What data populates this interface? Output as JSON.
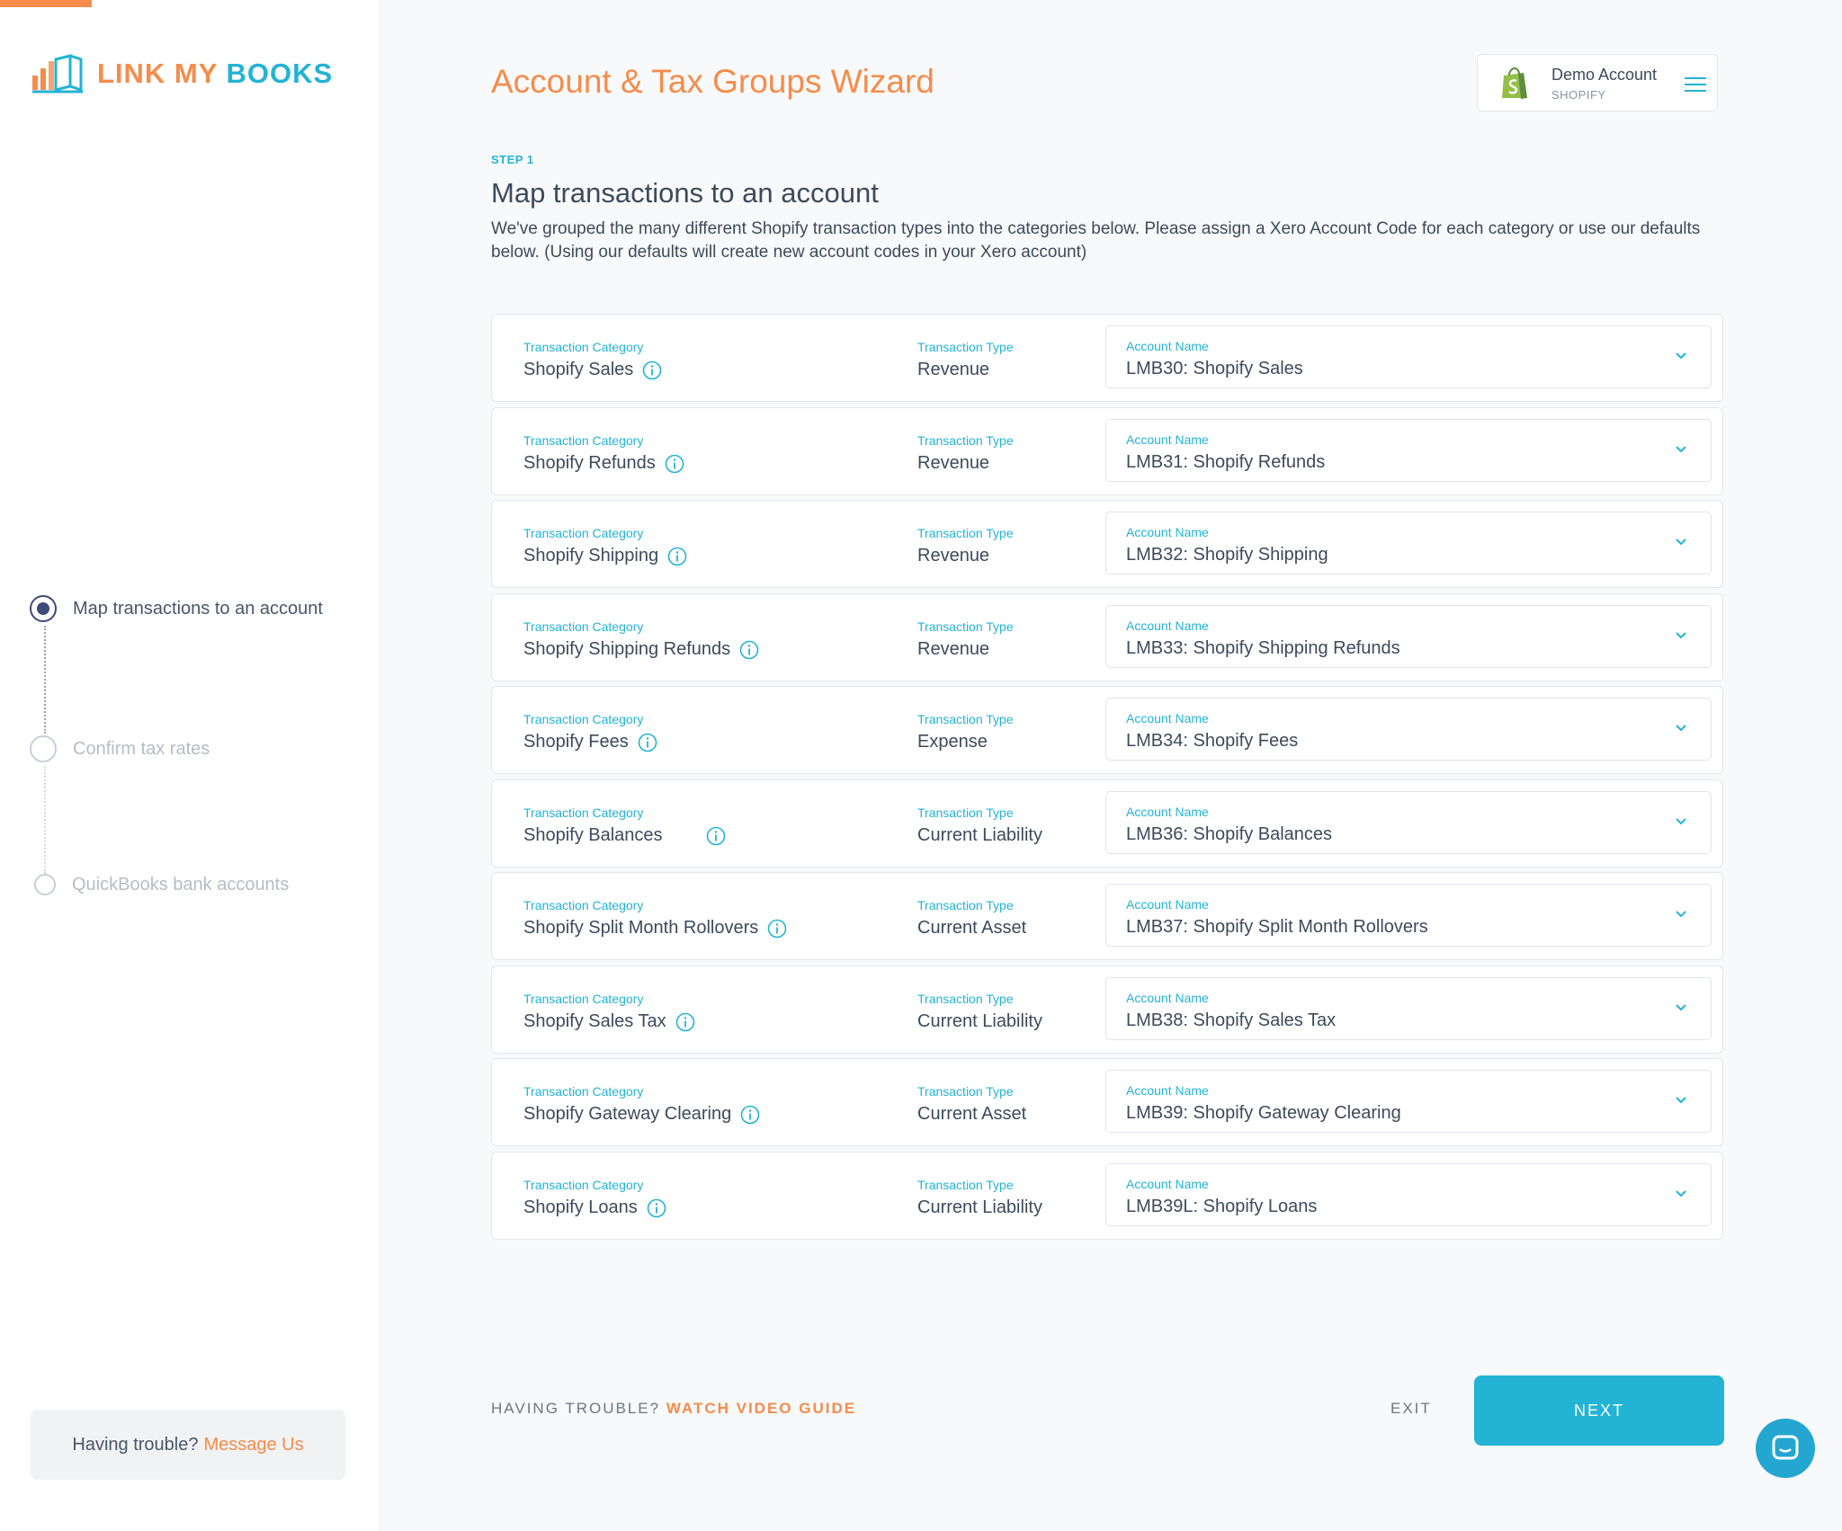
{
  "brand": {
    "logo_part1": "LINK MY",
    "logo_part2": "BOOKS",
    "accent": "#f58c4b",
    "teal": "#23b3d4"
  },
  "sidebar": {
    "steps": [
      {
        "label": "Map transactions to an account",
        "state": "active"
      },
      {
        "label": "Confirm tax rates",
        "state": "inactive"
      },
      {
        "label": "QuickBooks bank accounts",
        "state": "inactive"
      }
    ],
    "help": {
      "text": "Having trouble?",
      "link": "Message Us"
    }
  },
  "header": {
    "title": "Account & Tax Groups Wizard",
    "account": {
      "name": "Demo Account",
      "platform": "SHOPIFY"
    }
  },
  "content": {
    "step_tag": "STEP 1",
    "title": "Map transactions to an account",
    "description": "We've grouped the many different Shopify transaction types into the categories below. Please assign a Xero Account Code for each category or use our defaults below. (Using our defaults will create new account codes in your Xero account)",
    "labels": {
      "category": "Transaction Category",
      "type": "Transaction Type",
      "account": "Account Name"
    },
    "rows": [
      {
        "category": "Shopify Sales",
        "type": "Revenue",
        "account": "LMB30: Shopify Sales"
      },
      {
        "category": "Shopify Refunds",
        "type": "Revenue",
        "account": "LMB31: Shopify Refunds"
      },
      {
        "category": "Shopify Shipping",
        "type": "Revenue",
        "account": "LMB32: Shopify Shipping"
      },
      {
        "category": "Shopify Shipping Refunds",
        "type": "Revenue",
        "account": "LMB33: Shopify Shipping Refunds"
      },
      {
        "category": "Shopify Fees",
        "type": "Expense",
        "account": "LMB34: Shopify Fees"
      },
      {
        "category": "Shopify Balances",
        "type": "Current Liability",
        "account": "LMB36: Shopify Balances"
      },
      {
        "category": "Shopify Split Month Rollovers",
        "type": "Current Asset",
        "account": "LMB37: Shopify Split Month Rollovers"
      },
      {
        "category": "Shopify Sales Tax",
        "type": "Current Liability",
        "account": "LMB38: Shopify Sales Tax"
      },
      {
        "category": "Shopify Gateway Clearing",
        "type": "Current Asset",
        "account": "LMB39: Shopify Gateway Clearing"
      },
      {
        "category": "Shopify Loans",
        "type": "Current Liability",
        "account": "LMB39L: Shopify Loans"
      }
    ]
  },
  "footer": {
    "trouble_text": "HAVING TROUBLE?",
    "trouble_link": "WATCH VIDEO GUIDE",
    "exit_label": "EXIT",
    "next_label": "NEXT"
  },
  "icons": {
    "info": "info-icon",
    "chevron": "chevron-down-icon",
    "menu": "hamburger-icon",
    "chat": "chat-icon",
    "shopify": "shopify-bag-icon"
  }
}
